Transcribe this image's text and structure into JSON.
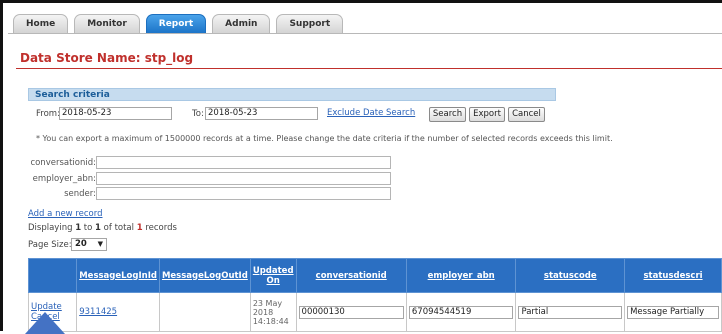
{
  "nav": {
    "tabs": [
      {
        "label": "Home"
      },
      {
        "label": "Monitor"
      },
      {
        "label": "Report"
      },
      {
        "label": "Admin"
      },
      {
        "label": "Support"
      }
    ],
    "active_tab": "Report"
  },
  "page": {
    "title": "Data Store Name: stp_log"
  },
  "search": {
    "header": "Search criteria",
    "from_label": "From:",
    "from_value": "2018-05-23",
    "to_label": "To:",
    "to_value": "2018-05-23",
    "exclude_link": "Exclude Date Search",
    "search_button": "Search",
    "export_button": "Export",
    "cancel_button": "Cancel",
    "note": "* You can export a maximum of 1500000 records at a time. Please change the date criteria if the number of selected records exceeds this limit.",
    "filters": [
      {
        "label": "conversationid:",
        "value": ""
      },
      {
        "label": "employer_abn:",
        "value": ""
      },
      {
        "label": "sender:",
        "value": ""
      }
    ]
  },
  "records": {
    "add_link": "Add a new record",
    "display_prefix": "Displaying ",
    "display_from": "1",
    "display_mid1": " to ",
    "display_to": "1",
    "display_mid2": " of total ",
    "display_total": "1",
    "display_suffix": " records",
    "page_size_label": "Page Size:",
    "page_size_value": "20"
  },
  "table": {
    "columns": [
      "",
      "MessageLogInId",
      "MessageLogOutId",
      "Updated On",
      "conversationid",
      "employer_abn",
      "statuscode",
      "statusdescri"
    ],
    "row": {
      "update_link": "Update",
      "cancel_link": "Cancel",
      "message_log_in_id": "9311425",
      "message_log_out_id": "",
      "updated_line1": "23 May",
      "updated_line2": "2018",
      "updated_line3": "14:18:44",
      "conversationid": "00000130",
      "employer_abn": "67094544519",
      "statuscode": "Partial",
      "statusdescription": "Message Partially"
    }
  },
  "colors": {
    "accent_red": "#c0302c",
    "tab_active": "#1c74c8",
    "header_blue": "#2b6fc2",
    "link_blue": "#2a62b9"
  }
}
